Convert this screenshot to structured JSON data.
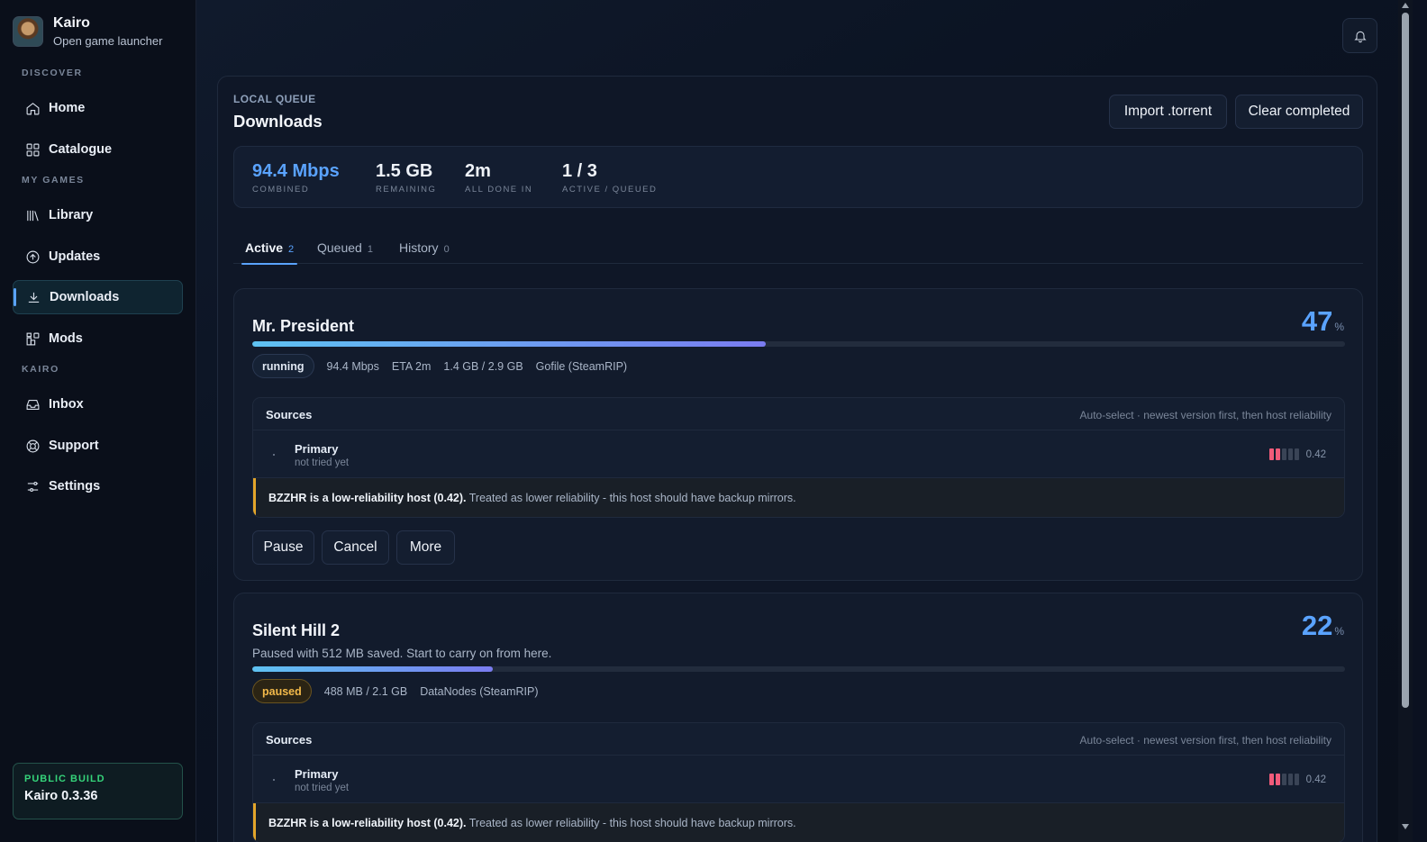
{
  "brand": {
    "name": "Kairo",
    "subtitle": "Open game launcher"
  },
  "sidebar": {
    "sections": [
      {
        "label": "DISCOVER"
      },
      {
        "label": "MY GAMES"
      },
      {
        "label": "KAIRO"
      }
    ],
    "items": [
      {
        "label": "Home",
        "icon": "home-icon"
      },
      {
        "label": "Catalogue",
        "icon": "grid-icon"
      },
      {
        "label": "Library",
        "icon": "library-icon"
      },
      {
        "label": "Updates",
        "icon": "arrow-up-circle-icon"
      },
      {
        "label": "Downloads",
        "icon": "download-icon",
        "active": true
      },
      {
        "label": "Mods",
        "icon": "puzzle-icon"
      },
      {
        "label": "Inbox",
        "icon": "inbox-icon"
      },
      {
        "label": "Support",
        "icon": "lifebuoy-icon"
      },
      {
        "label": "Settings",
        "icon": "sliders-icon"
      }
    ],
    "build": {
      "label": "PUBLIC BUILD",
      "version": "Kairo 0.3.36"
    }
  },
  "header": {
    "eyebrow": "LOCAL QUEUE",
    "title": "Downloads",
    "import_label": "Import .torrent",
    "clear_label": "Clear completed"
  },
  "stats": [
    {
      "value": "94.4 Mbps",
      "label": "COMBINED"
    },
    {
      "value": "1.5 GB",
      "label": "REMAINING"
    },
    {
      "value": "2m",
      "label": "ALL DONE IN"
    },
    {
      "value": "1 / 3",
      "label": "ACTIVE / QUEUED"
    }
  ],
  "tabs": [
    {
      "label": "Active",
      "count": "2"
    },
    {
      "label": "Queued",
      "count": "1"
    },
    {
      "label": "History",
      "count": "0"
    }
  ],
  "downloads": [
    {
      "title": "Mr. President",
      "percent": "47",
      "percent_sym": "%",
      "progress": 0.47,
      "status": "running",
      "speed": "94.4 Mbps",
      "eta": "ETA 2m",
      "size": "1.4 GB / 2.9 GB",
      "host": "Gofile (SteamRIP)",
      "sources_title": "Sources",
      "sources_hint": "Auto-select · newest version first, then host reliability",
      "source_name": "Primary",
      "source_status": "not tried yet",
      "reliability": "0.42",
      "warn_bold": "BZZHR is a low-reliability host (0.42).",
      "warn_text": " Treated as lower reliability - this host should have backup mirrors.",
      "actions": [
        "Pause",
        "Cancel",
        "More"
      ]
    },
    {
      "title": "Silent Hill 2",
      "percent": "22",
      "percent_sym": "%",
      "progress": 0.22,
      "note": "Paused with 512 MB saved. Start to carry on from here.",
      "status": "paused",
      "size": "488 MB / 2.1 GB",
      "host": "DataNodes (SteamRIP)",
      "sources_title": "Sources",
      "sources_hint": "Auto-select · newest version first, then host reliability",
      "source_name": "Primary",
      "source_status": "not tried yet",
      "reliability": "0.42",
      "warn_bold": "BZZHR is a low-reliability host (0.42).",
      "warn_text": " Treated as lower reliability - this host should have backup mirrors."
    }
  ],
  "colors": {
    "accent": "#5aa3ff",
    "running": "#dfe7f2",
    "paused": "#f2b94a",
    "warning": "#e3a52a",
    "reliability_bar": "#f25b7a",
    "build_label": "#35d37a"
  }
}
